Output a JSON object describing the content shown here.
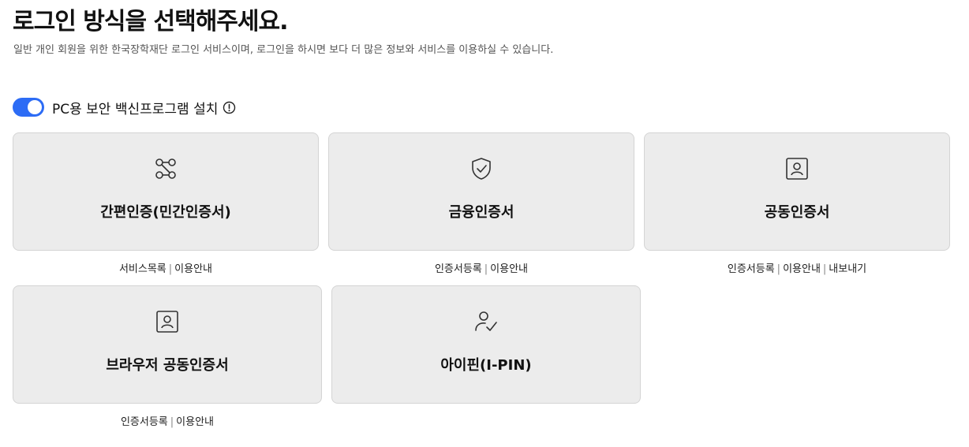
{
  "header": {
    "title": "로그인 방식을 선택해주세요.",
    "subtitle": "일반 개인 회원을 위한 한국장학재단 로그인 서비스이며, 로그인을 하시면 보다 더 많은 정보와 서비스를 이용하실 수 있습니다."
  },
  "security_toggle": {
    "label": "PC용 보안 백신프로그램 설치",
    "enabled": true,
    "icon": "info-icon"
  },
  "colors": {
    "accent": "#2d6cf5",
    "card_bg": "#ececec",
    "card_border": "#d4d4d4"
  },
  "login_methods": [
    {
      "label": "간편인증(민간인증서)",
      "icon": "connection-nodes-icon",
      "links": [
        "서비스목록",
        "이용안내"
      ]
    },
    {
      "label": "금융인증서",
      "icon": "shield-check-icon",
      "links": [
        "인증서등록",
        "이용안내"
      ]
    },
    {
      "label": "공동인증서",
      "icon": "user-certificate-icon",
      "links": [
        "인증서등록",
        "이용안내",
        "내보내기"
      ]
    },
    {
      "label": "브라우저 공동인증서",
      "icon": "user-certificate-icon",
      "links": [
        "인증서등록",
        "이용안내"
      ]
    },
    {
      "label": "아이핀(I-PIN)",
      "icon": "user-check-icon",
      "links": []
    }
  ],
  "separator": "|"
}
